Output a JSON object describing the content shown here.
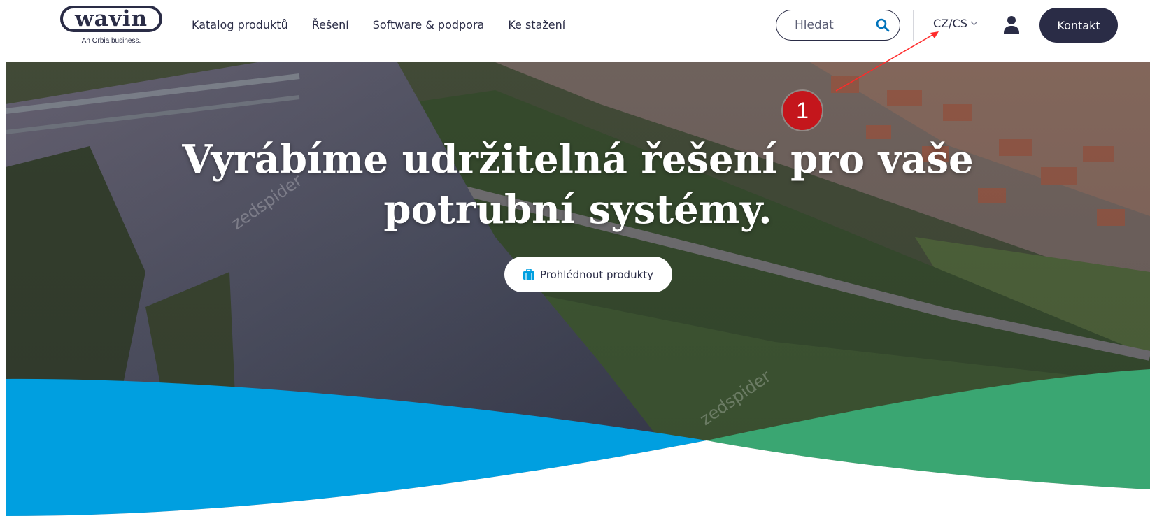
{
  "logo": {
    "wordmark": "wavin",
    "tagline": "An Orbia business."
  },
  "nav": {
    "items": [
      {
        "label": "Katalog produktů"
      },
      {
        "label": "Řešení"
      },
      {
        "label": "Software & podpora"
      },
      {
        "label": "Ke stažení"
      }
    ]
  },
  "search": {
    "placeholder": "Hledat",
    "icon": "search-icon"
  },
  "locale": {
    "label": "CZ/CS",
    "icon": "chevron-down-icon"
  },
  "user": {
    "icon": "user-icon"
  },
  "contact": {
    "label": "Kontakt"
  },
  "hero": {
    "title_line1": "Vyrábíme udržitelná řešení pro vaše",
    "title_line2": "potrubní systémy.",
    "button_label": "Prohlédnout produkty",
    "button_icon": "briefcase-icon",
    "watermark": "zedspider"
  },
  "annotation": {
    "badge": "1"
  },
  "colors": {
    "navy": "#2a2c46",
    "accent_blue": "#009fe0",
    "accent_green": "#3aa672",
    "search_icon": "#0073bb",
    "annotation_red": "#c4161c",
    "river": "#5b5f6e"
  }
}
